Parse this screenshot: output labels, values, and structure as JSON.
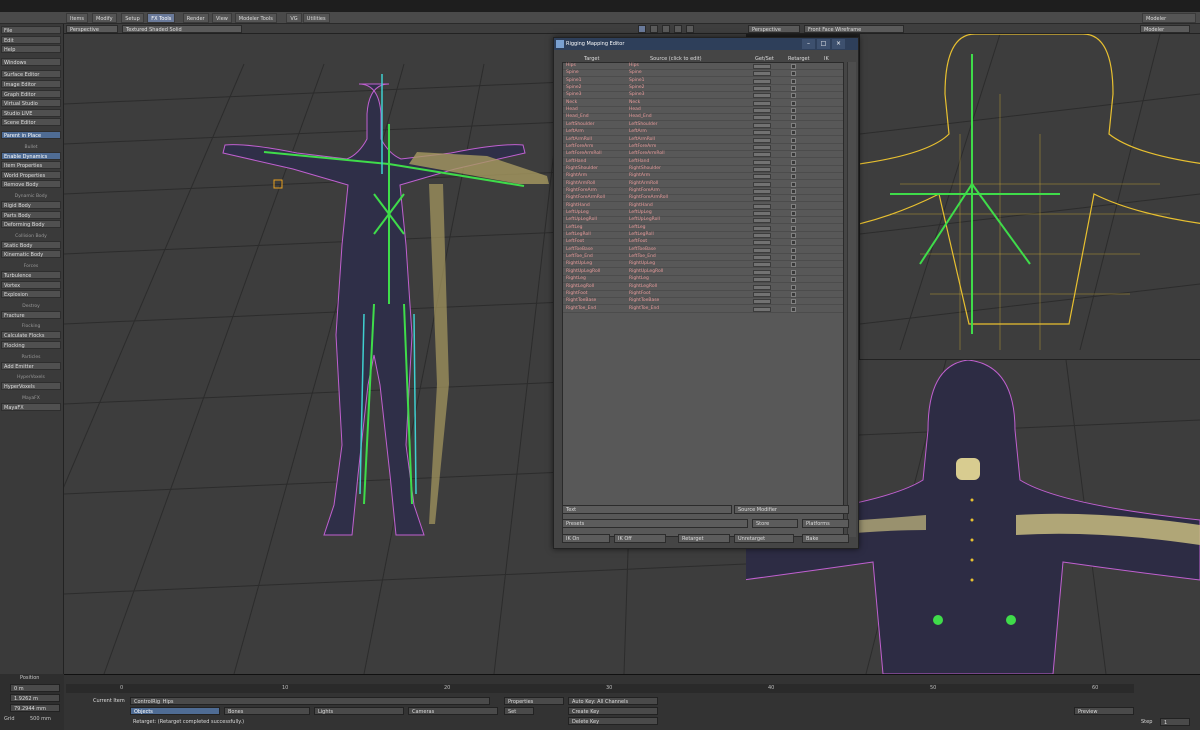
{
  "menu_tabs": [
    "Items",
    "Modify",
    "Setup",
    "FX Tools",
    "Render",
    "View",
    "Modeler Tools",
    "VG",
    "Utilities"
  ],
  "active_tab": "FX Tools",
  "layout_label": "Modeler",
  "viewport_left": {
    "view": "Perspective",
    "shading": "Textured Shaded Solid"
  },
  "viewport_right": {
    "view": "Perspective",
    "shading": "Front Face Wireframe"
  },
  "left_menu": {
    "top": [
      "File",
      "Edit",
      "Help"
    ],
    "window": "Windows",
    "editors": [
      "Surface Editor",
      "Image Editor",
      "Graph Editor",
      "Virtual Studio",
      "Studio LIVE",
      "Scene Editor"
    ],
    "parent_in_place": "Parent in Place",
    "groups": [
      {
        "head": "Bullet",
        "items": [
          "Enable Dynamics",
          "Item Properties",
          "World Properties",
          "Remove Body"
        ]
      },
      {
        "head": "Dynamic Body",
        "items": [
          "Rigid Body",
          "Parts Body",
          "Deforming Body"
        ]
      },
      {
        "head": "Collision Body",
        "items": [
          "Static Body",
          "Kinematic Body"
        ]
      },
      {
        "head": "Forces",
        "items": [
          "Turbulence",
          "Vortex",
          "Explosion"
        ]
      },
      {
        "head": "Destroy",
        "items": [
          "Fracture"
        ]
      },
      {
        "head": "Flocking",
        "items": [
          "Calculate Flocks",
          "Flocking"
        ]
      },
      {
        "head": "Particles",
        "items": [
          "Add Emitter"
        ]
      },
      {
        "head": "HyperVoxels",
        "items": [
          "HyperVoxels"
        ]
      },
      {
        "head": "MayaFX",
        "items": [
          "MayaFX"
        ]
      }
    ]
  },
  "dialog": {
    "title": "Rigging Mapping Editor",
    "columns": [
      "Target",
      "Source (click to edit)",
      "Get/Set",
      "Retarget",
      "IK"
    ],
    "rows": [
      [
        "Hips",
        "Hips"
      ],
      [
        "Spine",
        "Spine"
      ],
      [
        "Spine1",
        "Spine1"
      ],
      [
        "Spine2",
        "Spine2"
      ],
      [
        "Spine3",
        "Spine3"
      ],
      [
        "Neck",
        "Neck"
      ],
      [
        "Head",
        "Head"
      ],
      [
        "Head_End",
        "Head_End"
      ],
      [
        "LeftShoulder",
        "LeftShoulder"
      ],
      [
        "LeftArm",
        "LeftArm"
      ],
      [
        "LeftArmRoll",
        "LeftArmRoll"
      ],
      [
        "LeftForeArm",
        "LeftForeArm"
      ],
      [
        "LeftForeArmRoll",
        "LeftForeArmRoll"
      ],
      [
        "LeftHand",
        "LeftHand"
      ],
      [
        "RightShoulder",
        "RightShoulder"
      ],
      [
        "RightArm",
        "RightArm"
      ],
      [
        "RightArmRoll",
        "RightArmRoll"
      ],
      [
        "RightForeArm",
        "RightForeArm"
      ],
      [
        "RightForeArmRoll",
        "RightForeArmRoll"
      ],
      [
        "RightHand",
        "RightHand"
      ],
      [
        "LeftUpLeg",
        "LeftUpLeg"
      ],
      [
        "LeftUpLegRoll",
        "LeftUpLegRoll"
      ],
      [
        "LeftLeg",
        "LeftLeg"
      ],
      [
        "LeftLegRoll",
        "LeftLegRoll"
      ],
      [
        "LeftFoot",
        "LeftFoot"
      ],
      [
        "LeftToeBase",
        "LeftToeBase"
      ],
      [
        "LeftToe_End",
        "LeftToe_End"
      ],
      [
        "RightUpLeg",
        "RightUpLeg"
      ],
      [
        "RightUpLegRoll",
        "RightUpLegRoll"
      ],
      [
        "RightLeg",
        "RightLeg"
      ],
      [
        "RightLegRoll",
        "RightLegRoll"
      ],
      [
        "RightFoot",
        "RightFoot"
      ],
      [
        "RightToeBase",
        "RightToeBase"
      ],
      [
        "RightToe_End",
        "RightToe_End"
      ]
    ],
    "getset_label": "Get Set",
    "text_label": "Text",
    "source_field": "Source Modifier",
    "presets_label": "Presets",
    "store_label": "Store",
    "platform_label": "Platforms",
    "btn_ik_on": "IK On",
    "btn_ik_off": "IK Off",
    "btn_retarget": "Retarget",
    "btn_unretarget": "Unretarget",
    "btn_bake": "Bake"
  },
  "timeline": {
    "position_label": "Position",
    "ticks": [
      "0",
      "10",
      "20",
      "30",
      "40",
      "50",
      "60"
    ],
    "current_item_label": "Current Item",
    "current_item": "ControlRig_Hips",
    "properties": "Properties",
    "objects": "Objects",
    "bones": "Bones",
    "lights": "Lights",
    "cameras": "Cameras",
    "auto_key": "Auto Key: All Channels",
    "create_key": "Create Key",
    "delete_key": "Delete Key",
    "status": "Retarget: (Retarget completed successfully.)",
    "set_label": "Set",
    "preview": "Preview",
    "step": "Step",
    "step_value": "1",
    "grid_label": "Grid",
    "grid_value": "500 mm",
    "left_values": [
      "0 m",
      "1.9262 m",
      "79.2944 mm"
    ]
  },
  "colors": {
    "accent_blue": "#4f6c94",
    "bone_green": "#3fdc4a",
    "bone_cyan": "#3fd0d0",
    "wire_yellow": "#e8c030",
    "row_text_red": "#e79a9a"
  }
}
